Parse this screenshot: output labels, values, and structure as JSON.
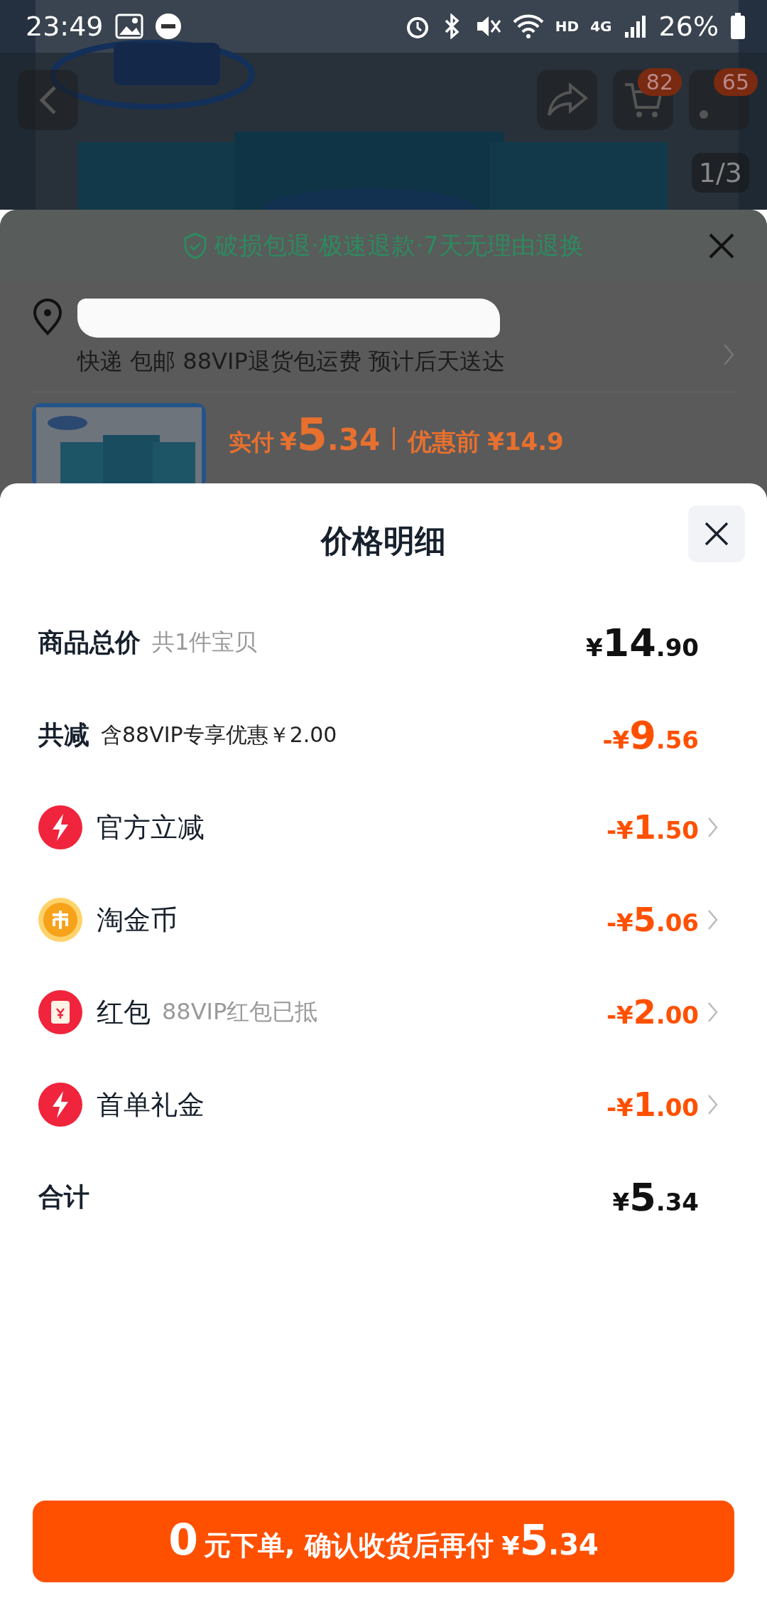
{
  "status_bar": {
    "time": "23:49",
    "hd": "HD",
    "network": "4G",
    "battery": "26%"
  },
  "product_header": {
    "cart_badge": "82",
    "message_badge": "65",
    "image_counter": "1/3"
  },
  "order_sheet": {
    "guarantee": "破损包退·极速退款·7天无理由退换",
    "delivery": "快递 包邮 88VIP退货包运费 预计后天送达",
    "paid_label": "实付",
    "paid_currency": "¥",
    "paid_integer": "5",
    "paid_decimal": ".34",
    "before_label": "优惠前",
    "before_price": "¥14.9"
  },
  "price_detail": {
    "title": "价格明细",
    "rows": [
      {
        "kind": "summary",
        "label": "商品总价",
        "note": "共1件宝贝",
        "prefix": "¥",
        "integer": "14",
        "decimal": ".90"
      },
      {
        "kind": "reduction",
        "label": "共减",
        "note": "含88VIP专享优惠￥2.00",
        "prefix": "-¥",
        "integer": "9",
        "decimal": ".56"
      },
      {
        "kind": "bolt",
        "label": "官方立减",
        "prefix": "-¥",
        "integer": "1",
        "decimal": ".50"
      },
      {
        "kind": "coin",
        "label": "淘金币",
        "prefix": "-¥",
        "integer": "5",
        "decimal": ".06"
      },
      {
        "kind": "packet",
        "label": "红包",
        "note": "88VIP红包已抵",
        "prefix": "-¥",
        "integer": "2",
        "decimal": ".00"
      },
      {
        "kind": "bolt",
        "label": "首单礼金",
        "prefix": "-¥",
        "integer": "1",
        "decimal": ".00"
      },
      {
        "kind": "summary",
        "label": "合计",
        "prefix": "¥",
        "integer": "5",
        "decimal": ".34"
      }
    ]
  },
  "pay_button": {
    "zero": "0",
    "text": "元下单, 确认收货后再付",
    "currency": "¥",
    "integer": "5",
    "decimal": ".34"
  }
}
